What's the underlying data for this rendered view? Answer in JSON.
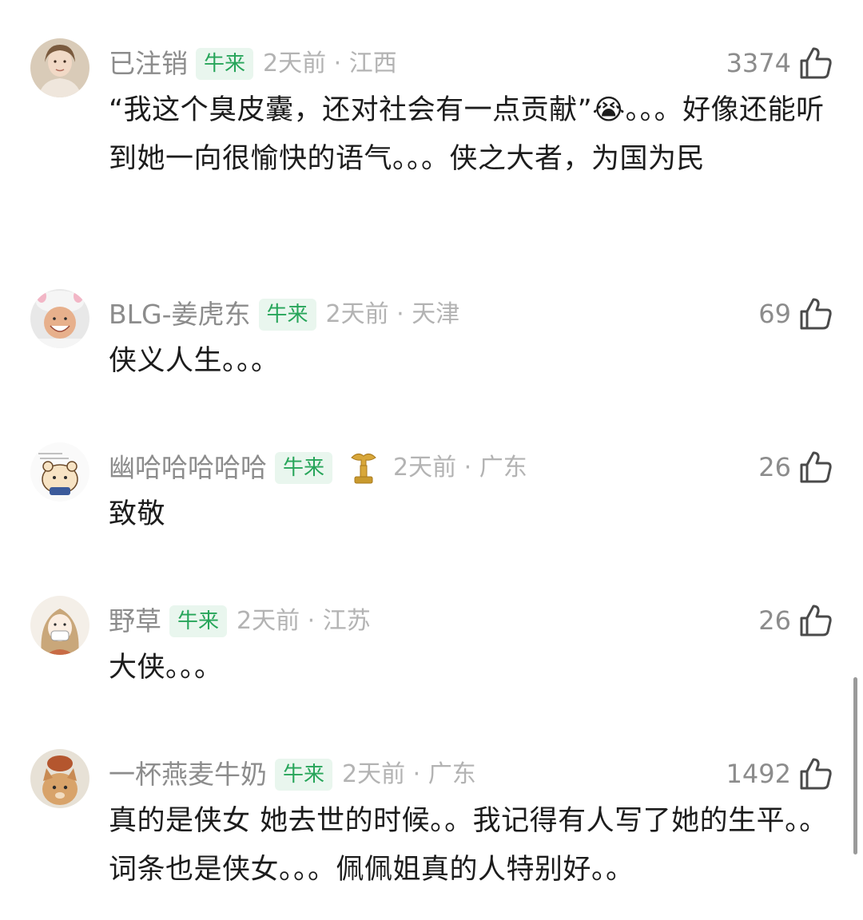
{
  "badge_label": "牛来",
  "comments": [
    {
      "username": "已注销",
      "time_location": "2天前 · 江西",
      "likes": "3374",
      "text": "“我这个臭皮囊，还对社会有一点贡献”😭。。。好像还能听到她一向很愉快的语气。。。侠之大者，为国为民"
    },
    {
      "username": "BLG-姜虎东",
      "time_location": "2天前 · 天津",
      "likes": "69",
      "text": "侠义人生。。。"
    },
    {
      "username": "幽哈哈哈哈哈",
      "time_location": "2天前 · 广东",
      "likes": "26",
      "text": "致敬"
    },
    {
      "username": "野草",
      "time_location": "2天前 · 江苏",
      "likes": "26",
      "text": "大侠。。。"
    },
    {
      "username": "一杯燕麦牛奶",
      "time_location": "2天前 · 广东",
      "likes": "1492",
      "text": "真的是侠女 她去世的时候。。我记得有人写了她的生平。。词条也是侠女。。。佩佩姐真的人特别好。。"
    }
  ],
  "colors": {
    "badge_bg": "#e9f6ee",
    "badge_text": "#27a55a",
    "username": "#8c8c8c",
    "meta": "#b3b3b3"
  },
  "icons": [
    "thumbs-up-icon",
    "medal-icon",
    "avatar"
  ]
}
